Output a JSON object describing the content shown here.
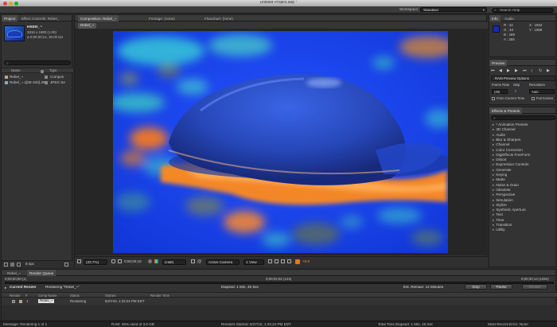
{
  "window": {
    "title": "Untitled Project.aep *"
  },
  "header": {
    "workspace_label": "Workspace:",
    "workspace_value": "Standard",
    "search_placeholder": "Search Help"
  },
  "project_panel": {
    "tabs": [
      "Project",
      "Effect Controls: Rebel_"
    ],
    "asset_name": "Rebel_~",
    "asset_info": [
      "2816 x 1880 (1.00)",
      "Δ 0;00;30;14, 30.00 fps"
    ],
    "columns": {
      "name": "Name",
      "type": "Type"
    },
    "items": [
      {
        "name": "Rebel_~",
        "type": "Compos"
      },
      {
        "name": "Rebel_~.1[00-100].JPG",
        "type": "JPEG Se"
      }
    ],
    "bpc": "8 bpc"
  },
  "viewer": {
    "tabs": [
      "Composition: Rebel_~",
      "Footage: (none)",
      "Flowchart: (none)"
    ],
    "comp_tab": "Rebel_~",
    "toolbar": {
      "zoom": "(33.7%)",
      "timecode": "0;00;00;16",
      "resolution": "(Half)",
      "camera": "Active Camera",
      "view": "1 View",
      "exposure": "+0.0"
    }
  },
  "info_panel": {
    "tabs": [
      "Info",
      "Audio"
    ],
    "values": {
      "R": "R : 24",
      "G": "G : 43",
      "B": "B : 169",
      "A": "A : 255",
      "X": "X : 1563",
      "Y": "Y : 1868"
    }
  },
  "preview_panel": {
    "tab": "Preview",
    "ram_options": "RAM Preview Options",
    "labels": {
      "frame_rate": "Frame Rate",
      "skip": "Skip",
      "resolution": "Resolution"
    },
    "values": {
      "frame_rate": "(30)",
      "skip": "0",
      "resolution": "Auto"
    },
    "from_current": "From Current Time",
    "full_screen": "Full Screen"
  },
  "effects_panel": {
    "tab": "Effects & Presets",
    "items": [
      "* Animation Presets",
      "3D Channel",
      "Audio",
      "Blur & Sharpen",
      "Channel",
      "Color Correction",
      "DigiEffects FreeForm",
      "Distort",
      "Expression Controls",
      "Generate",
      "Keying",
      "Matte",
      "Noise & Grain",
      "Obsolete",
      "Perspective",
      "Simulation",
      "Stylize",
      "Synthetic Aperture",
      "Text",
      "Time",
      "Transition",
      "Utility"
    ]
  },
  "render_queue": {
    "tabs": [
      "Rebel_~",
      "Render Queue"
    ],
    "progress": 0.0,
    "time_start": "0;00;00;00 (1)",
    "time_mid": "0;00;04;02 (123)",
    "time_end": "0;00;30;13 (1094)",
    "current_render_label": "Current Render",
    "rendering_label": "Rendering \"Rebel_~\"",
    "elapsed": "Elapsed: 1 Min, 45 Sec",
    "est_remain": "Est. Remain: 14 Minutes",
    "buttons": {
      "stop": "Stop",
      "pause": "Pause",
      "render": "Render"
    },
    "columns": [
      "Render",
      "#",
      "Comp Name",
      "Status",
      "Started",
      "Render Time"
    ],
    "row": {
      "num": "1",
      "comp": "Rebel_~",
      "status": "Rendering",
      "started": "8/27/10, 1:34:24 PM EDT"
    }
  },
  "statusbar": {
    "message": "Message: Rendering 1 of 1",
    "ram": "RAM: 45% used of 3.0 GB",
    "renders_started": "Renders Started: 8/27/10, 1:34:24 PM EDT",
    "total_elapsed": "Total Time Elapsed: 1 Min, 45 Sec",
    "recent_error": "Most Recent Error: None"
  },
  "colors": {
    "accent_blue": "#1f4fff",
    "panel_bg": "#333333",
    "app_bg": "#2b2b2b",
    "orange": "#ff7a1a"
  }
}
